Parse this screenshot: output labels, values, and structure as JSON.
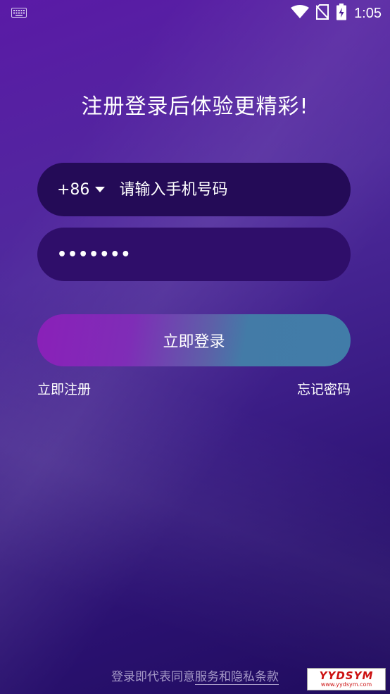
{
  "status_bar": {
    "time": "1:05",
    "icons": [
      "keyboard-icon",
      "wifi-icon",
      "no-sim-icon",
      "battery-charging-icon"
    ]
  },
  "title": "注册登录后体验更精彩!",
  "phone_field": {
    "country_code": "+86",
    "placeholder": "请输入手机号码"
  },
  "password_field": {
    "masked_value": "•••••••"
  },
  "login_button": {
    "label": "立即登录"
  },
  "links": {
    "register": "立即注册",
    "forgot_password": "忘记密码"
  },
  "agreement": {
    "prefix": "登录即代表同意",
    "terms": "服务和隐私条款"
  },
  "watermark": {
    "brand": "YYDSYM",
    "url": "www.yydsym.com"
  },
  "colors": {
    "background_top": "#5a1aa6",
    "background_bottom": "#200c5e",
    "phone_field_bg": "#240b57",
    "password_field_bg": "#2f0e6a",
    "button_gradient_start": "#8a20b8",
    "button_gradient_end": "#417ca8"
  }
}
